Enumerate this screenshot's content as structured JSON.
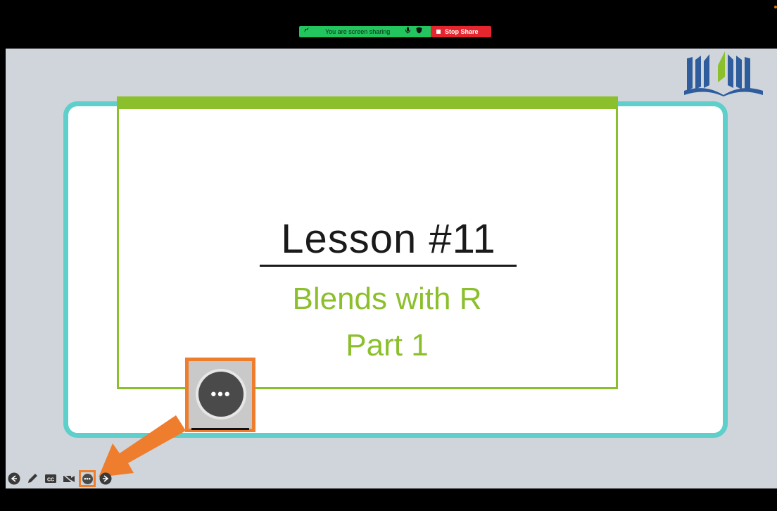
{
  "share_bar": {
    "status_text": "You are screen sharing",
    "stop_label": "Stop Share",
    "accent_green": "#22c55e",
    "stop_red": "#e5262e"
  },
  "slide": {
    "title": "Lesson #11",
    "subtitle_line1": "Blends with R",
    "subtitle_line2": "Part 1",
    "frame_color": "#5ecfca",
    "accent_green": "#8bbf2b"
  },
  "callout": {
    "icon": "more-options-icon",
    "dots": "•••",
    "highlight_color": "#ee7d2d"
  },
  "controls": {
    "items": [
      "prev-slide-icon",
      "pen-icon",
      "closed-caption-icon",
      "video-off-icon",
      "more-options-icon",
      "next-slide-icon"
    ],
    "cc_label": "CC",
    "more_dots": "•••"
  }
}
